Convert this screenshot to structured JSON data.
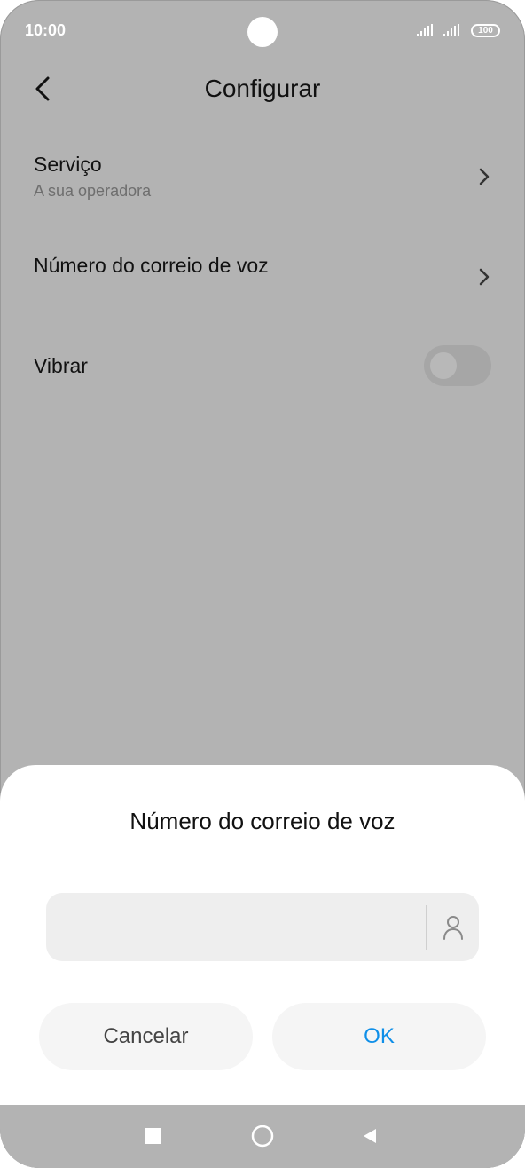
{
  "status_bar": {
    "time": "10:00",
    "battery": "100"
  },
  "header": {
    "title": "Configurar"
  },
  "settings": [
    {
      "title": "Serviço",
      "subtitle": "A sua operadora"
    },
    {
      "title": "Número do correio de voz"
    },
    {
      "title": "Vibrar",
      "toggle_on": false
    }
  ],
  "dialog": {
    "title": "Número do correio de voz",
    "input": {
      "value": "",
      "placeholder": ""
    },
    "cancel_label": "Cancelar",
    "ok_label": "OK"
  },
  "colors": {
    "accent": "#0f8fe8",
    "scrim": "#b3b3b3",
    "sheet": "#ffffff",
    "field": "#eeeeee"
  },
  "icons": [
    "back-arrow-icon",
    "chevron-right-icon",
    "contact-icon",
    "recents-icon",
    "home-icon",
    "nav-back-icon",
    "signal-icon",
    "battery-icon"
  ]
}
